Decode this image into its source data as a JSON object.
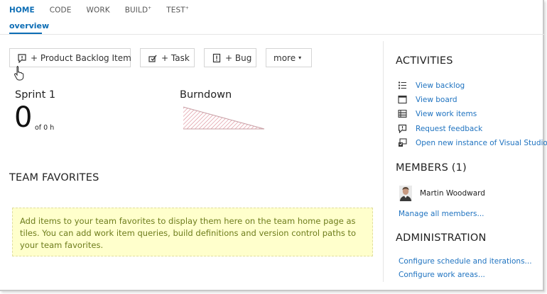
{
  "nav": {
    "items": [
      {
        "label": "HOME",
        "sup": ""
      },
      {
        "label": "CODE",
        "sup": ""
      },
      {
        "label": "WORK",
        "sup": ""
      },
      {
        "label": "BUILD",
        "sup": "+"
      },
      {
        "label": "TEST",
        "sup": "+"
      }
    ],
    "subnav": "overview"
  },
  "toolbar": {
    "pbi_label": "+ Product Backlog Item",
    "task_label": "+ Task",
    "bug_label": "+ Bug",
    "more_label": "more",
    "more_caret": "▾"
  },
  "sprint": {
    "title": "Sprint 1",
    "remaining": "0",
    "of_total": "of 0 h"
  },
  "burndown": {
    "title": "Burndown"
  },
  "favorites": {
    "title": "TEAM FAVORITES",
    "message": "Add items to your team favorites to display them here on the team home page as tiles. You can add work item queries, build definitions and version control paths to your team favorites."
  },
  "activities": {
    "title": "ACTIVITIES",
    "items": [
      {
        "label": "View backlog",
        "icon": "backlog-icon"
      },
      {
        "label": "View board",
        "icon": "board-icon"
      },
      {
        "label": "View work items",
        "icon": "work-items-icon"
      },
      {
        "label": "Request feedback",
        "icon": "feedback-icon"
      },
      {
        "label": "Open new instance of Visual Studio",
        "icon": "visual-studio-icon"
      }
    ]
  },
  "members": {
    "title": "MEMBERS (1)",
    "list": [
      {
        "name": "Martin Woodward"
      }
    ],
    "manage_link": "Manage all members..."
  },
  "administration": {
    "title": "ADMINISTRATION",
    "links": [
      "Configure schedule and iterations...",
      "Configure work areas..."
    ]
  },
  "colors": {
    "accent": "#0c6db5",
    "link": "#1f73c0",
    "favorites_bg": "#ffffcc",
    "favorites_text": "#6e7d1c",
    "burndown_hatch": "#d9838f"
  }
}
